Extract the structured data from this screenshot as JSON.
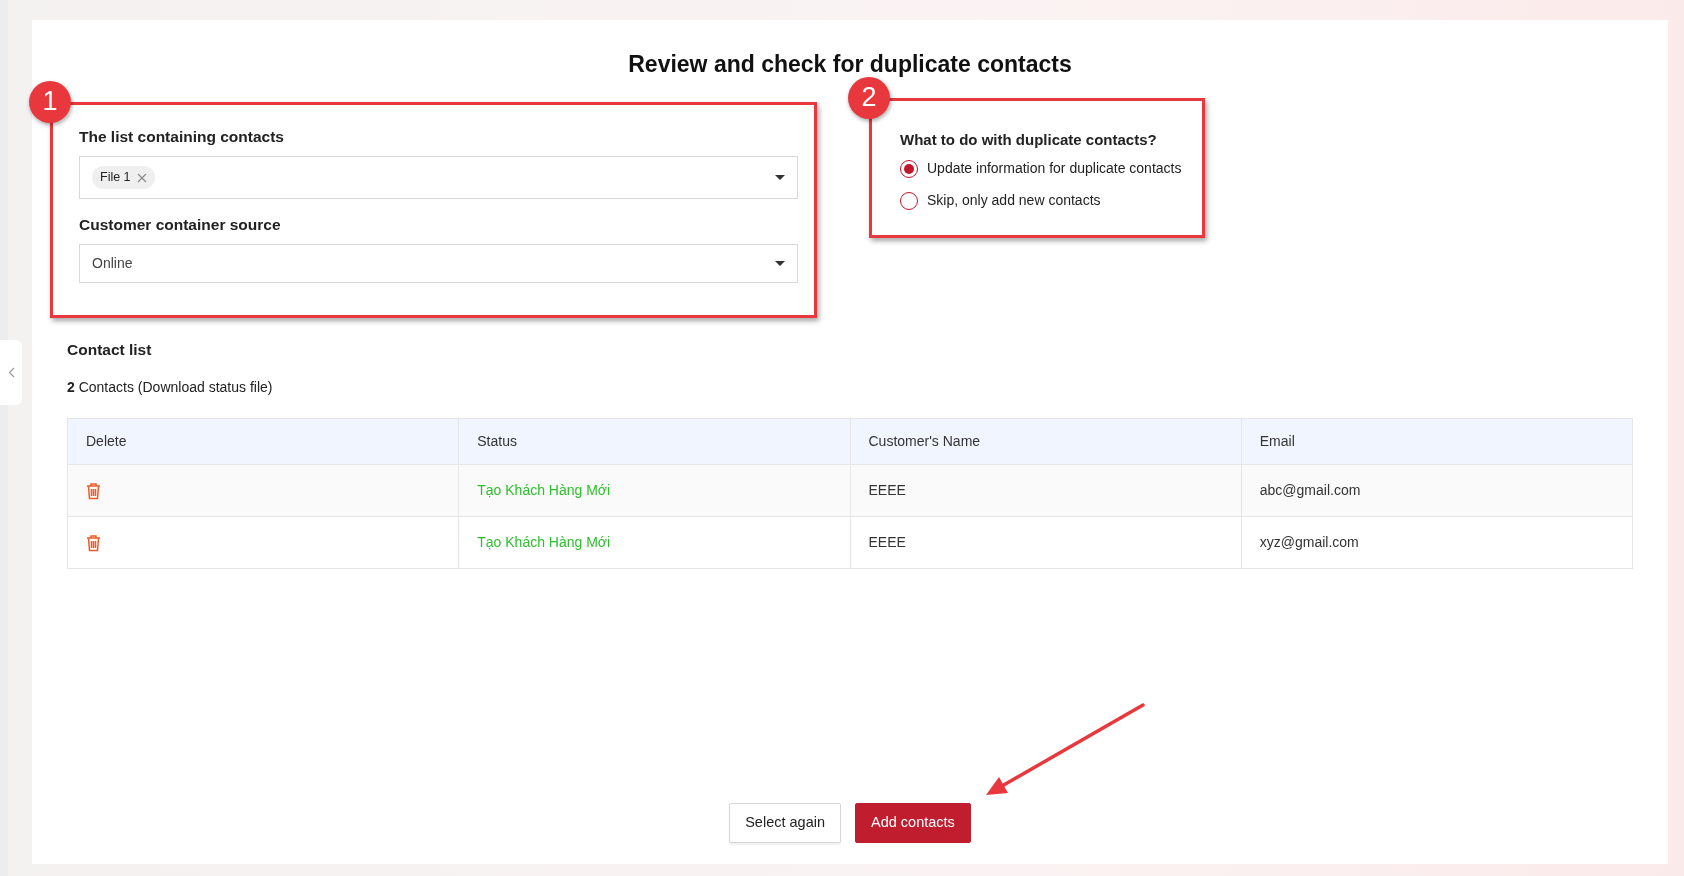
{
  "title": "Review and check for duplicate contacts",
  "source_panel": {
    "badge": "1",
    "fields": [
      {
        "label": "The list containing contacts",
        "kind": "tags",
        "tags": [
          "File 1"
        ]
      },
      {
        "label": "Customer container source",
        "kind": "select",
        "value": "Online"
      }
    ]
  },
  "duplicate_panel": {
    "badge": "2",
    "question": "What to do with duplicate contacts?",
    "options": [
      {
        "label": "Update information for duplicate contacts",
        "selected": true
      },
      {
        "label": "Skip, only add new contacts",
        "selected": false
      }
    ]
  },
  "contact_list": {
    "title": "Contact list",
    "summary": "**2** Contacts (Download status file)",
    "columns": [
      "Delete",
      "Status",
      "Customer's Name",
      "Email"
    ],
    "rows": [
      {
        "status": "Tạo Khách Hàng Mới",
        "name": "EEEE",
        "email": "abc@gmail.com"
      },
      {
        "status": "Tạo Khách Hàng Mới",
        "name": "EEEE",
        "email": "xyz@gmail.com"
      }
    ]
  },
  "buttons": [
    {
      "label": "Select again",
      "kind": "secondary"
    },
    {
      "label": "Add contacts",
      "kind": "primary"
    }
  ]
}
